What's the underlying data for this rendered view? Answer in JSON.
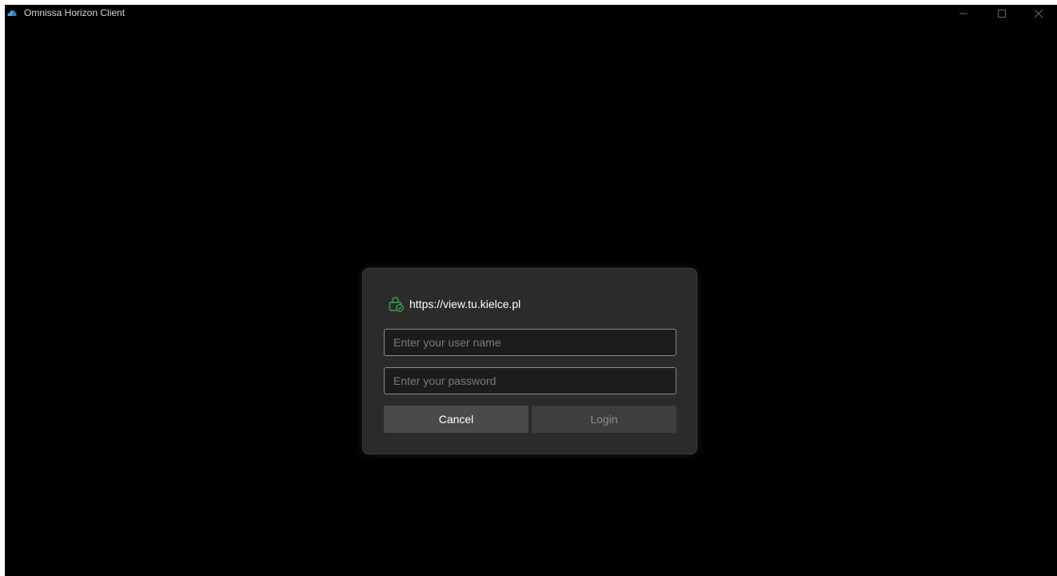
{
  "window": {
    "title": "Omnissa Horizon Client",
    "icon": "cloud-app-icon",
    "controls": {
      "minimize": "minimize-icon",
      "maximize": "maximize-icon",
      "close": "close-icon"
    }
  },
  "login_dialog": {
    "server_url": "https://view.tu.kielce.pl",
    "server_icon": "secure-server-icon",
    "username": {
      "value": "",
      "placeholder": "Enter your user name"
    },
    "password": {
      "value": "",
      "placeholder": "Enter your password"
    },
    "cancel_label": "Cancel",
    "login_label": "Login",
    "login_enabled": false
  },
  "colors": {
    "background": "#000000",
    "dialog": "#2b2b2b",
    "secure_icon": "#2fa84f",
    "cancel_button": "#4a4a4a",
    "login_button_disabled": "#3e3e3e"
  }
}
